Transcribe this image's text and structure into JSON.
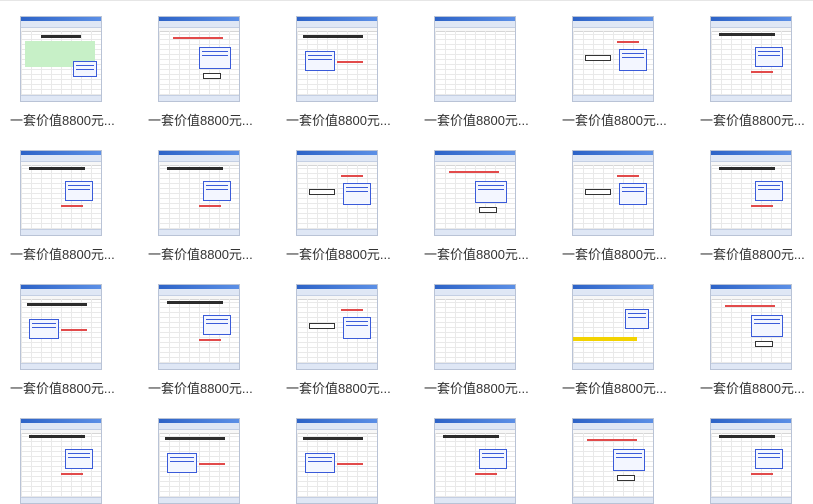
{
  "grid": {
    "items": [
      {
        "caption": "一套价值8800元...",
        "variant": "form"
      },
      {
        "caption": "一套价值8800元...",
        "variant": "note"
      },
      {
        "caption": "一套价值8800元...",
        "variant": "table"
      },
      {
        "caption": "一套价值8800元...",
        "variant": "blank"
      },
      {
        "caption": "一套价值8800元...",
        "variant": "box"
      },
      {
        "caption": "一套价值8800元...",
        "variant": "dense"
      },
      {
        "caption": "一套价值8800元...",
        "variant": "dense"
      },
      {
        "caption": "一套价值8800元...",
        "variant": "dense"
      },
      {
        "caption": "一套价值8800元...",
        "variant": "box"
      },
      {
        "caption": "一套价值8800元...",
        "variant": "note"
      },
      {
        "caption": "一套价值8800元...",
        "variant": "box"
      },
      {
        "caption": "一套价值8800元...",
        "variant": "dense"
      },
      {
        "caption": "一套价值8800元...",
        "variant": "table"
      },
      {
        "caption": "一套价值8800元...",
        "variant": "dense"
      },
      {
        "caption": "一套价值8800元...",
        "variant": "box"
      },
      {
        "caption": "一套价值8800元...",
        "variant": "blank"
      },
      {
        "caption": "一套价值8800元...",
        "variant": "yellow"
      },
      {
        "caption": "一套价值8800元...",
        "variant": "note"
      },
      {
        "caption": "",
        "variant": "dense"
      },
      {
        "caption": "",
        "variant": "table"
      },
      {
        "caption": "",
        "variant": "table"
      },
      {
        "caption": "",
        "variant": "dense"
      },
      {
        "caption": "",
        "variant": "note"
      },
      {
        "caption": "",
        "variant": "dense"
      }
    ]
  }
}
